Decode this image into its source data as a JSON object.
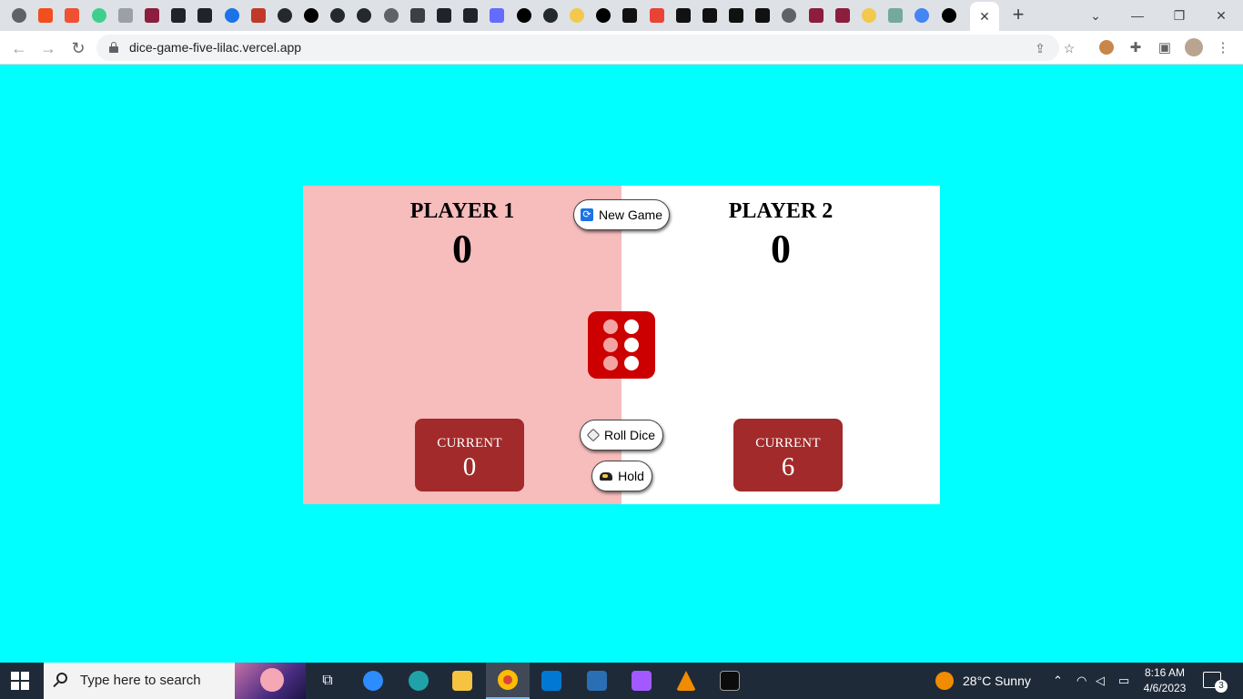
{
  "browser": {
    "url": "dice-game-five-lilac.vercel.app",
    "favicons": [
      {
        "name": "chrome-icon",
        "color": "#5f6368",
        "round": true
      },
      {
        "name": "figma-icon",
        "color": "#f24e1e"
      },
      {
        "name": "git-icon",
        "color": "#f05033"
      },
      {
        "name": "bolt-icon",
        "color": "#3ecf8e",
        "round": true
      },
      {
        "name": "reader-icon",
        "color": "#9aa0a6"
      },
      {
        "name": "gift-icon",
        "color": "#8b1e3f"
      },
      {
        "name": "react-icon",
        "color": "#20232a"
      },
      {
        "name": "react-icon",
        "color": "#20232a"
      },
      {
        "name": "lightning-icon",
        "color": "#1a73e8",
        "round": true
      },
      {
        "name": "dots-icon",
        "color": "#c0392b"
      },
      {
        "name": "github-icon",
        "color": "#24292e",
        "round": true
      },
      {
        "name": "medium-icon",
        "color": "#000000",
        "round": true
      },
      {
        "name": "github-icon",
        "color": "#24292e",
        "round": true
      },
      {
        "name": "github-icon",
        "color": "#24292e",
        "round": true
      },
      {
        "name": "globe-icon",
        "color": "#5f6368",
        "round": true
      },
      {
        "name": "jadoo-icon",
        "color": "#3c4043"
      },
      {
        "name": "react-icon",
        "color": "#20232a"
      },
      {
        "name": "react-icon",
        "color": "#20232a"
      },
      {
        "name": "vite-icon",
        "color": "#646cff"
      },
      {
        "name": "triangle-icon",
        "color": "#000000",
        "round": true
      },
      {
        "name": "github-icon",
        "color": "#24292e",
        "round": true
      },
      {
        "name": "pen-icon",
        "color": "#f2c94c",
        "round": true
      },
      {
        "name": "triangle-icon",
        "color": "#000000",
        "round": true
      },
      {
        "name": "code-icon",
        "color": "#111111"
      },
      {
        "name": "gmail-icon",
        "color": "#ea4335"
      },
      {
        "name": "code-icon",
        "color": "#111111"
      },
      {
        "name": "code-icon",
        "color": "#111111"
      },
      {
        "name": "code-icon",
        "color": "#111111"
      },
      {
        "name": "m-icon",
        "color": "#111111"
      },
      {
        "name": "globe-icon",
        "color": "#5f6368",
        "round": true
      },
      {
        "name": "gift-icon",
        "color": "#8b1e3f"
      },
      {
        "name": "gift-icon",
        "color": "#8b1e3f"
      },
      {
        "name": "pen-icon",
        "color": "#f2c94c",
        "round": true
      },
      {
        "name": "chatgpt-icon",
        "color": "#74aa9c"
      },
      {
        "name": "google-icon",
        "color": "#4285f4",
        "round": true
      },
      {
        "name": "triangle-icon",
        "color": "#000000",
        "round": true
      }
    ]
  },
  "game": {
    "player1": {
      "name": "PLAYER 1",
      "score": "0",
      "current_label": "CURRENT",
      "current": "0",
      "bg": "#f7bcbc"
    },
    "player2": {
      "name": "PLAYER 2",
      "score": "0",
      "current_label": "CURRENT",
      "current": "6",
      "bg": "#ffffff"
    },
    "buttons": {
      "new_game": "New Game",
      "roll_dice": "Roll Dice",
      "hold": "Hold"
    },
    "dice": {
      "value": 6,
      "color": "#cc0000"
    },
    "background": "#00ffff"
  },
  "taskbar": {
    "search_placeholder": "Type here to search",
    "weather": "28°C  Sunny",
    "time": "8:16 AM",
    "date": "4/6/2023",
    "notifications": "3"
  }
}
